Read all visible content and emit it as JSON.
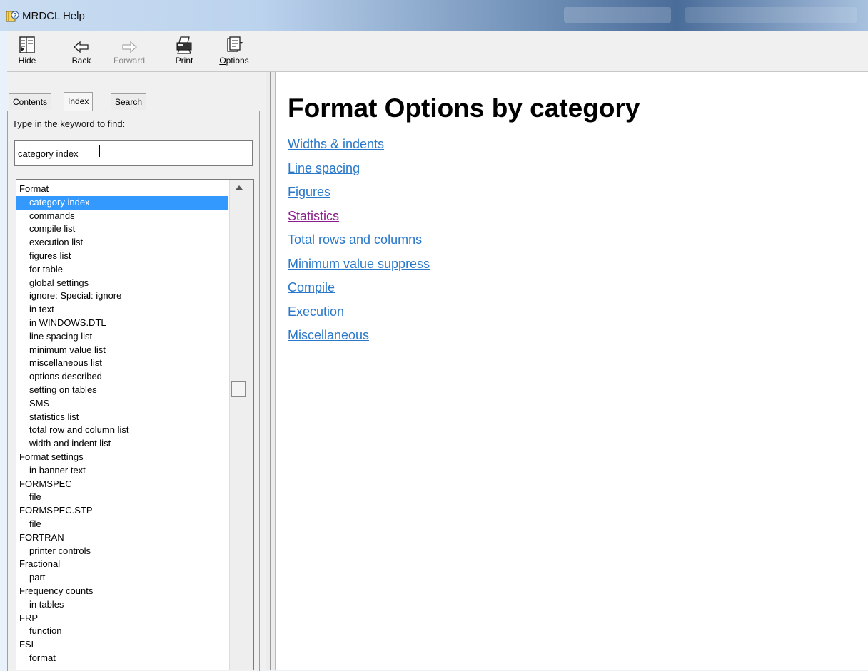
{
  "window": {
    "title": "MRDCL Help"
  },
  "toolbar": {
    "buttons": [
      {
        "label": "Hide",
        "icon": "hide-icon",
        "enabled": true
      },
      {
        "label": "Back",
        "icon": "back-arrow-icon",
        "enabled": true
      },
      {
        "label": "Forward",
        "icon": "forward-arrow-icon",
        "enabled": false
      },
      {
        "label": "Print",
        "icon": "printer-icon",
        "enabled": true
      },
      {
        "label": "Options",
        "icon": "options-icon",
        "enabled": true
      }
    ]
  },
  "tabs": [
    {
      "label": "Contents",
      "active": false
    },
    {
      "label": "Index",
      "active": true
    },
    {
      "label": "Search",
      "active": false
    }
  ],
  "index": {
    "prompt": "Type in the keyword to find:",
    "keyword_value": "category index",
    "items": [
      {
        "text": "Format",
        "level": 0
      },
      {
        "text": "category index",
        "level": 1,
        "selected": true
      },
      {
        "text": "commands",
        "level": 1
      },
      {
        "text": "compile list",
        "level": 1
      },
      {
        "text": "execution list",
        "level": 1
      },
      {
        "text": "figures list",
        "level": 1
      },
      {
        "text": "for table",
        "level": 1
      },
      {
        "text": "global settings",
        "level": 1
      },
      {
        "text": "ignore: Special: ignore",
        "level": 1
      },
      {
        "text": "in text",
        "level": 1
      },
      {
        "text": "in WINDOWS.DTL",
        "level": 1
      },
      {
        "text": "line spacing list",
        "level": 1
      },
      {
        "text": "minimum value list",
        "level": 1
      },
      {
        "text": "miscellaneous list",
        "level": 1
      },
      {
        "text": "options described",
        "level": 1
      },
      {
        "text": "setting on tables",
        "level": 1
      },
      {
        "text": "SMS",
        "level": 1
      },
      {
        "text": "statistics list",
        "level": 1
      },
      {
        "text": "total row and column list",
        "level": 1
      },
      {
        "text": "width and indent list",
        "level": 1
      },
      {
        "text": "Format settings",
        "level": 0
      },
      {
        "text": "in banner text",
        "level": 1
      },
      {
        "text": "FORMSPEC",
        "level": 0
      },
      {
        "text": "file",
        "level": 1
      },
      {
        "text": "FORMSPEC.STP",
        "level": 0
      },
      {
        "text": "file",
        "level": 1
      },
      {
        "text": "FORTRAN",
        "level": 0
      },
      {
        "text": "printer controls",
        "level": 1
      },
      {
        "text": "Fractional",
        "level": 0
      },
      {
        "text": "part",
        "level": 1
      },
      {
        "text": "Frequency counts",
        "level": 0
      },
      {
        "text": "in tables",
        "level": 1
      },
      {
        "text": "FRP",
        "level": 0
      },
      {
        "text": "function",
        "level": 1
      },
      {
        "text": "FSL",
        "level": 0
      },
      {
        "text": "format",
        "level": 1
      }
    ]
  },
  "content": {
    "heading": "Format Options by category",
    "links": [
      {
        "text": "Widths & indents",
        "visited": false
      },
      {
        "text": "Line spacing",
        "visited": false
      },
      {
        "text": "Figures",
        "visited": false
      },
      {
        "text": "Statistics",
        "visited": true
      },
      {
        "text": "Total rows and columns",
        "visited": false
      },
      {
        "text": "Minimum value suppress",
        "visited": false
      },
      {
        "text": "Compile",
        "visited": false
      },
      {
        "text": "Execution",
        "visited": false
      },
      {
        "text": "Miscellaneous",
        "visited": false
      }
    ]
  },
  "colors": {
    "link": "#2a78c9",
    "visited_link": "#8b1d8b",
    "selection": "#3399ff"
  }
}
